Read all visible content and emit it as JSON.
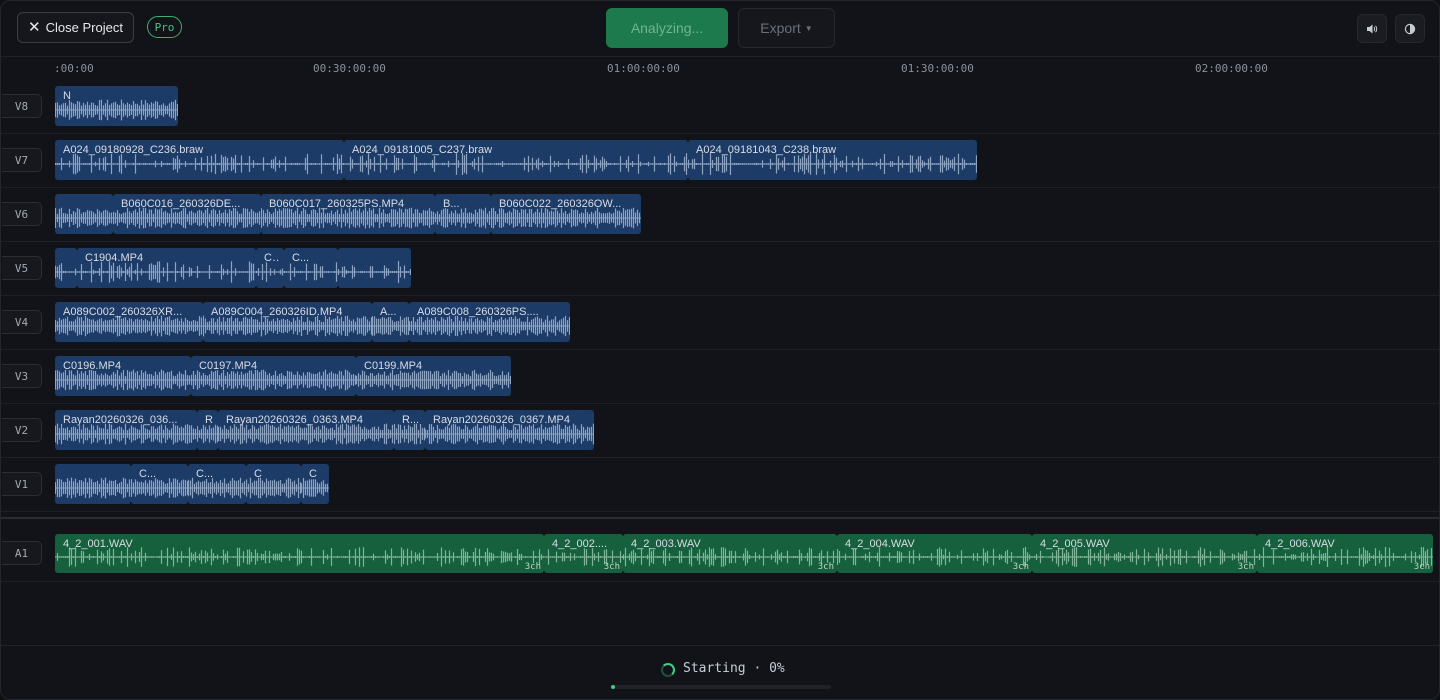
{
  "header": {
    "close_label": "Close Project",
    "pro_badge": "Pro",
    "analyze_label": "Analyzing...",
    "export_label": "Export",
    "volume_icon": "speaker-icon",
    "theme_icon": "contrast-icon"
  },
  "ruler": {
    "ticks": [
      ":00:00",
      "00:30:00:00",
      "01:00:00:00",
      "01:30:00:00",
      "02:00:00:00"
    ]
  },
  "tracks": [
    {
      "id": "V8",
      "kind": "video",
      "clips": [
        {
          "name": "N"
        }
      ]
    },
    {
      "id": "V7",
      "kind": "video",
      "clips": [
        {
          "name": "A024_09180928_C236.braw"
        },
        {
          "name": "A024_09181005_C237.braw"
        },
        {
          "name": "A024_09181043_C238.braw"
        }
      ]
    },
    {
      "id": "V6",
      "kind": "video",
      "clips": [
        {
          "name": ""
        },
        {
          "name": "B060C016_260326DE..."
        },
        {
          "name": "B060C017_260325PS.MP4"
        },
        {
          "name": "B..."
        },
        {
          "name": "B060C022_260326OW..."
        }
      ]
    },
    {
      "id": "V5",
      "kind": "video",
      "clips": [
        {
          "name": ""
        },
        {
          "name": "C1904.MP4"
        },
        {
          "name": "C..."
        },
        {
          "name": "C..."
        },
        {
          "name": ""
        }
      ]
    },
    {
      "id": "V4",
      "kind": "video",
      "clips": [
        {
          "name": "A089C002_260326XR..."
        },
        {
          "name": "A089C004_260326ID.MP4"
        },
        {
          "name": "A..."
        },
        {
          "name": "A089C008_260326PS...."
        }
      ]
    },
    {
      "id": "V3",
      "kind": "video",
      "clips": [
        {
          "name": "C0196.MP4"
        },
        {
          "name": "C0197.MP4"
        },
        {
          "name": "C0199.MP4"
        }
      ]
    },
    {
      "id": "V2",
      "kind": "video",
      "clips": [
        {
          "name": "Rayan20260326_036..."
        },
        {
          "name": "R"
        },
        {
          "name": "Rayan20260326_0363.MP4"
        },
        {
          "name": "R..."
        },
        {
          "name": "Rayan20260326_0367.MP4"
        }
      ]
    },
    {
      "id": "V1",
      "kind": "video",
      "clips": [
        {
          "name": ""
        },
        {
          "name": "C..."
        },
        {
          "name": "C..."
        },
        {
          "name": "C"
        },
        {
          "name": "C"
        }
      ]
    },
    {
      "id": "A1",
      "kind": "audio",
      "clips": [
        {
          "name": "4_2_001.WAV",
          "channels": "3ch"
        },
        {
          "name": "4_2_002....",
          "channels": "3ch"
        },
        {
          "name": "4_2_003.WAV",
          "channels": "3ch"
        },
        {
          "name": "4_2_004.WAV",
          "channels": "3ch"
        },
        {
          "name": "4_2_005.WAV",
          "channels": "3ch"
        },
        {
          "name": "4_2_006.WAV",
          "channels": "3ch"
        }
      ]
    }
  ],
  "status": {
    "text": "Starting · 0%",
    "progress": 0.02
  },
  "colors": {
    "video_clip": "#1d3b67",
    "audio_clip": "#17603d",
    "accent_green": "#3fcf82",
    "analyze_bg": "#1d7a4d"
  }
}
